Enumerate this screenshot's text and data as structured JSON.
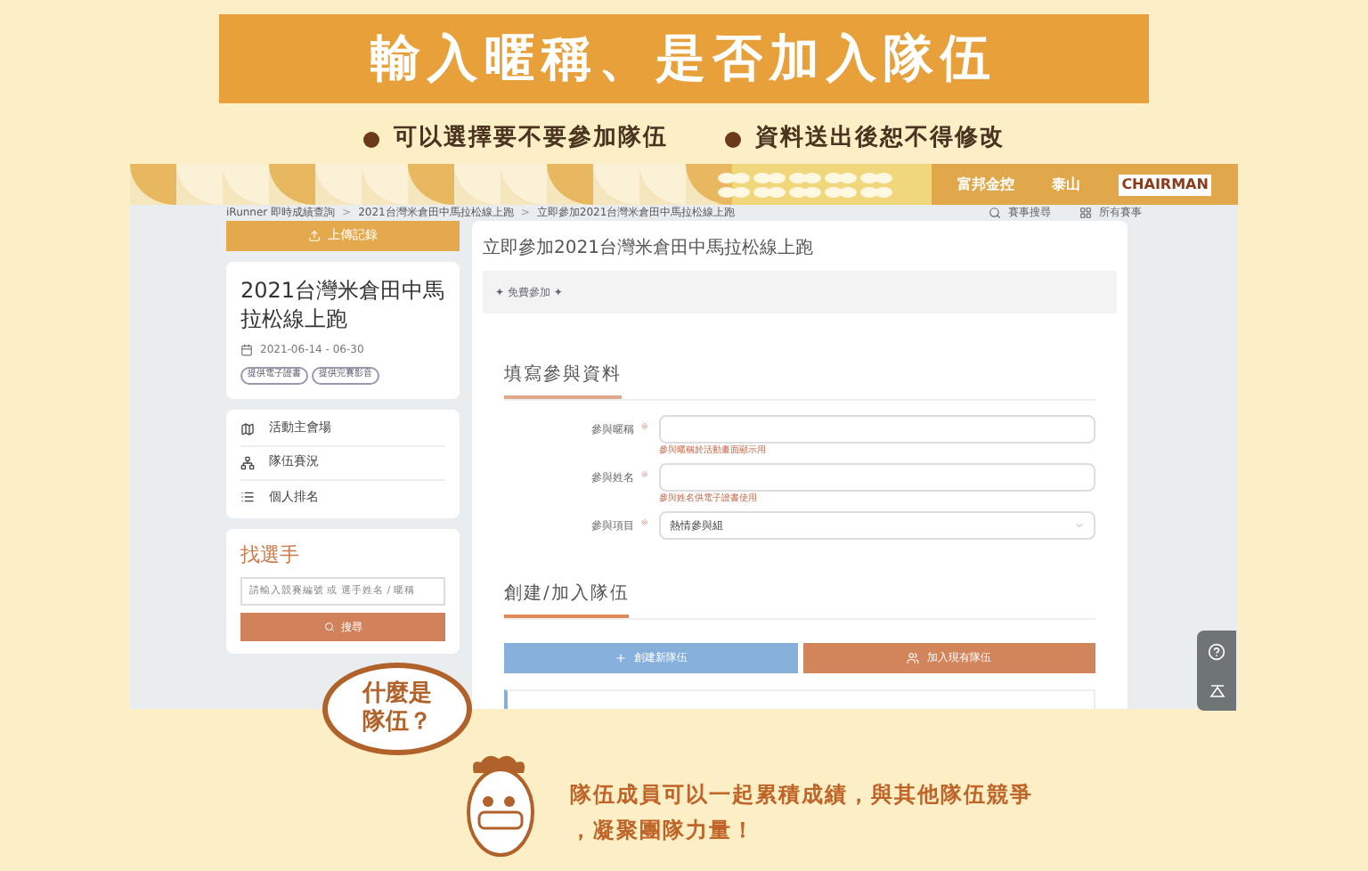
{
  "banner": {
    "title": "輸入暱稱、是否加入隊伍",
    "notes": [
      "可以選擇要不要參加隊伍",
      "資料送出後恕不得修改"
    ]
  },
  "screen": {
    "sponsors": [
      "富邦金控",
      "泰山",
      "CHAIRMAN"
    ],
    "breadcrumb": [
      {
        "kind": "link",
        "text": "iRunner 即時成績查詢"
      },
      {
        "kind": "separator",
        "text": ">"
      },
      {
        "kind": "link",
        "text": "2021台灣米倉田中馬拉松線上跑"
      },
      {
        "kind": "separator",
        "text": ">"
      },
      {
        "kind": "link",
        "text": "立即參加2021台灣米倉田中馬拉松線上跑"
      }
    ],
    "top_links": [
      {
        "kind": "search",
        "label": "賽事搜尋"
      },
      {
        "kind": "grid",
        "label": "所有賽事"
      }
    ],
    "upload_button": "上傳記錄",
    "event": {
      "title": "2021台灣米倉田中馬拉松線上跑",
      "dates": "2021-06-14 - 06-30",
      "tags": [
        "提供電子證書",
        "提供完賽影音"
      ]
    },
    "menu": [
      {
        "kind": "map",
        "label": "活動主會場"
      },
      {
        "kind": "team",
        "label": "隊伍賽況"
      },
      {
        "kind": "list",
        "label": "個人排名"
      }
    ],
    "finder": {
      "title": "找選手",
      "placeholder": "請輸入競賽編號 或 選手姓名 / 暱稱",
      "button": "搜尋"
    },
    "main": {
      "title": "立即參加2021台灣米倉田中馬拉松線上跑",
      "plan": "✦ 免費參加 ✦",
      "form_heading": "填寫參與資料",
      "fields": [
        {
          "kind": "text",
          "label": "參與暱稱",
          "required": "※",
          "hint": "參與暱稱於活動畫面顯示用"
        },
        {
          "kind": "text",
          "label": "參與姓名",
          "required": "※",
          "hint": "參與姓名供電子證書使用"
        },
        {
          "kind": "select",
          "label": "參與項目",
          "required": "※",
          "value": "熱情參與組"
        }
      ],
      "team_heading": "創建/加入隊伍",
      "team_buttons": [
        {
          "kind": "create",
          "label": "創建新隊伍"
        },
        {
          "kind": "join",
          "label": "加入現有隊伍"
        }
      ]
    }
  },
  "bubble": [
    "什麼是",
    "隊伍？"
  ],
  "caption": [
    "隊伍成員可以一起累積成績，與其他隊伍競爭",
    "，凝聚團隊力量！"
  ]
}
